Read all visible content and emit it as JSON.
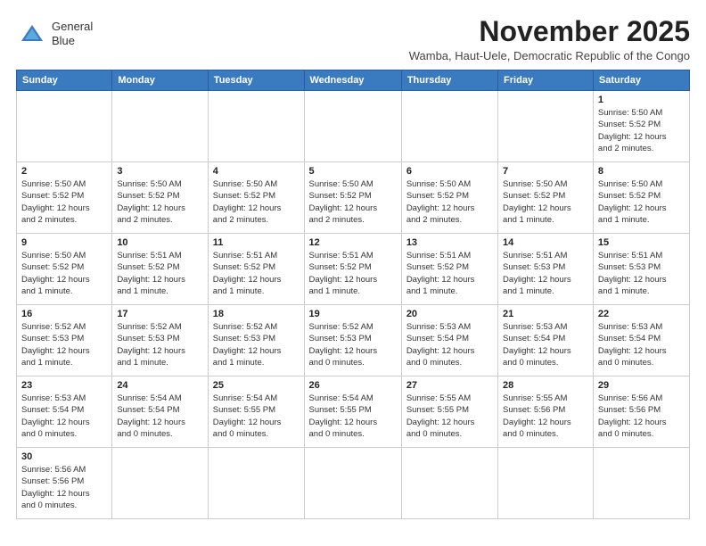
{
  "logo": {
    "line1": "General",
    "line2": "Blue"
  },
  "title": "November 2025",
  "subtitle": "Wamba, Haut-Uele, Democratic Republic of the Congo",
  "days_of_week": [
    "Sunday",
    "Monday",
    "Tuesday",
    "Wednesday",
    "Thursday",
    "Friday",
    "Saturday"
  ],
  "weeks": [
    [
      {
        "day": null,
        "info": null
      },
      {
        "day": null,
        "info": null
      },
      {
        "day": null,
        "info": null
      },
      {
        "day": null,
        "info": null
      },
      {
        "day": null,
        "info": null
      },
      {
        "day": null,
        "info": null
      },
      {
        "day": "1",
        "info": "Sunrise: 5:50 AM\nSunset: 5:52 PM\nDaylight: 12 hours\nand 2 minutes."
      }
    ],
    [
      {
        "day": "2",
        "info": "Sunrise: 5:50 AM\nSunset: 5:52 PM\nDaylight: 12 hours\nand 2 minutes."
      },
      {
        "day": "3",
        "info": "Sunrise: 5:50 AM\nSunset: 5:52 PM\nDaylight: 12 hours\nand 2 minutes."
      },
      {
        "day": "4",
        "info": "Sunrise: 5:50 AM\nSunset: 5:52 PM\nDaylight: 12 hours\nand 2 minutes."
      },
      {
        "day": "5",
        "info": "Sunrise: 5:50 AM\nSunset: 5:52 PM\nDaylight: 12 hours\nand 2 minutes."
      },
      {
        "day": "6",
        "info": "Sunrise: 5:50 AM\nSunset: 5:52 PM\nDaylight: 12 hours\nand 2 minutes."
      },
      {
        "day": "7",
        "info": "Sunrise: 5:50 AM\nSunset: 5:52 PM\nDaylight: 12 hours\nand 1 minute."
      },
      {
        "day": "8",
        "info": "Sunrise: 5:50 AM\nSunset: 5:52 PM\nDaylight: 12 hours\nand 1 minute."
      }
    ],
    [
      {
        "day": "9",
        "info": "Sunrise: 5:50 AM\nSunset: 5:52 PM\nDaylight: 12 hours\nand 1 minute."
      },
      {
        "day": "10",
        "info": "Sunrise: 5:51 AM\nSunset: 5:52 PM\nDaylight: 12 hours\nand 1 minute."
      },
      {
        "day": "11",
        "info": "Sunrise: 5:51 AM\nSunset: 5:52 PM\nDaylight: 12 hours\nand 1 minute."
      },
      {
        "day": "12",
        "info": "Sunrise: 5:51 AM\nSunset: 5:52 PM\nDaylight: 12 hours\nand 1 minute."
      },
      {
        "day": "13",
        "info": "Sunrise: 5:51 AM\nSunset: 5:52 PM\nDaylight: 12 hours\nand 1 minute."
      },
      {
        "day": "14",
        "info": "Sunrise: 5:51 AM\nSunset: 5:53 PM\nDaylight: 12 hours\nand 1 minute."
      },
      {
        "day": "15",
        "info": "Sunrise: 5:51 AM\nSunset: 5:53 PM\nDaylight: 12 hours\nand 1 minute."
      }
    ],
    [
      {
        "day": "16",
        "info": "Sunrise: 5:52 AM\nSunset: 5:53 PM\nDaylight: 12 hours\nand 1 minute."
      },
      {
        "day": "17",
        "info": "Sunrise: 5:52 AM\nSunset: 5:53 PM\nDaylight: 12 hours\nand 1 minute."
      },
      {
        "day": "18",
        "info": "Sunrise: 5:52 AM\nSunset: 5:53 PM\nDaylight: 12 hours\nand 1 minute."
      },
      {
        "day": "19",
        "info": "Sunrise: 5:52 AM\nSunset: 5:53 PM\nDaylight: 12 hours\nand 0 minutes."
      },
      {
        "day": "20",
        "info": "Sunrise: 5:53 AM\nSunset: 5:54 PM\nDaylight: 12 hours\nand 0 minutes."
      },
      {
        "day": "21",
        "info": "Sunrise: 5:53 AM\nSunset: 5:54 PM\nDaylight: 12 hours\nand 0 minutes."
      },
      {
        "day": "22",
        "info": "Sunrise: 5:53 AM\nSunset: 5:54 PM\nDaylight: 12 hours\nand 0 minutes."
      }
    ],
    [
      {
        "day": "23",
        "info": "Sunrise: 5:53 AM\nSunset: 5:54 PM\nDaylight: 12 hours\nand 0 minutes."
      },
      {
        "day": "24",
        "info": "Sunrise: 5:54 AM\nSunset: 5:54 PM\nDaylight: 12 hours\nand 0 minutes."
      },
      {
        "day": "25",
        "info": "Sunrise: 5:54 AM\nSunset: 5:55 PM\nDaylight: 12 hours\nand 0 minutes."
      },
      {
        "day": "26",
        "info": "Sunrise: 5:54 AM\nSunset: 5:55 PM\nDaylight: 12 hours\nand 0 minutes."
      },
      {
        "day": "27",
        "info": "Sunrise: 5:55 AM\nSunset: 5:55 PM\nDaylight: 12 hours\nand 0 minutes."
      },
      {
        "day": "28",
        "info": "Sunrise: 5:55 AM\nSunset: 5:56 PM\nDaylight: 12 hours\nand 0 minutes."
      },
      {
        "day": "29",
        "info": "Sunrise: 5:56 AM\nSunset: 5:56 PM\nDaylight: 12 hours\nand 0 minutes."
      }
    ],
    [
      {
        "day": "30",
        "info": "Sunrise: 5:56 AM\nSunset: 5:56 PM\nDaylight: 12 hours\nand 0 minutes."
      },
      {
        "day": null,
        "info": null
      },
      {
        "day": null,
        "info": null
      },
      {
        "day": null,
        "info": null
      },
      {
        "day": null,
        "info": null
      },
      {
        "day": null,
        "info": null
      },
      {
        "day": null,
        "info": null
      }
    ]
  ]
}
